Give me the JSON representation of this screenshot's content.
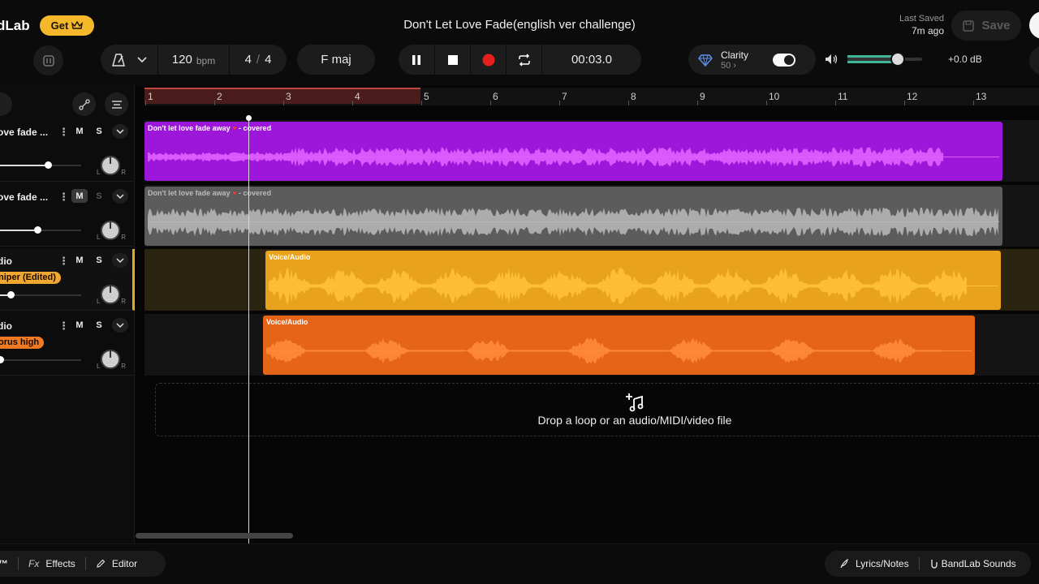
{
  "app": {
    "brand": "dLab",
    "get_label": "Get",
    "title": "Don't Let Love Fade(english ver challenge)",
    "last_saved_label": "Last Saved",
    "last_saved_ago": "7m ago",
    "save_label": "Save"
  },
  "transport": {
    "bpm": "120",
    "bpm_unit": "bpm",
    "time_sig_num": "4",
    "time_sig_sep": "/",
    "time_sig_den": "4",
    "key": "F maj",
    "time": "00:03.0"
  },
  "clarity": {
    "label": "Clarity",
    "value": "50 ›",
    "enabled": true
  },
  "master_volume": {
    "readout": "+0.0 dB",
    "level_fraction": 0.65
  },
  "ruler": {
    "bars": [
      "1",
      "2",
      "3",
      "4",
      "5",
      "6",
      "7",
      "8",
      "9",
      "10",
      "11",
      "12",
      "13"
    ],
    "loop_range": [
      1,
      5
    ]
  },
  "tracks": [
    {
      "name": "ove fade ...",
      "m_label": "M",
      "s_label": "S",
      "muted": false,
      "volume_fraction": 0.37,
      "color": "#a11ee0",
      "region_label": "Don't let love fade away",
      "region_suffix": "- covered"
    },
    {
      "name": "ove fade ...",
      "m_label": "M",
      "s_label": "S",
      "muted": true,
      "volume_fraction": 0.29,
      "color": "#5e5e5e",
      "region_label": "Don't let love fade away",
      "region_suffix": "- covered"
    },
    {
      "name": "dio",
      "m_label": "M",
      "s_label": "S",
      "muted": false,
      "tag": "niper (Edited)",
      "tag_color": "#f0a830",
      "volume_fraction": 0.08,
      "color": "#e9a41f",
      "region_label": "Voice/Audio"
    },
    {
      "name": "dio",
      "m_label": "M",
      "s_label": "S",
      "muted": false,
      "tag": "orus high",
      "tag_color": "#f07a24",
      "volume_fraction": 0.0,
      "color": "#e8671d",
      "region_label": "Voice/Audio"
    }
  ],
  "drop_zone": {
    "text": "Drop a loop or an audio/MIDI/video file"
  },
  "bottom": {
    "trademark": "™",
    "effects_prefix": "Fx",
    "effects_label": "Effects",
    "editor_label": "Editor",
    "lyrics_label": "Lyrics/Notes",
    "sounds_label": "BandLab Sounds"
  }
}
